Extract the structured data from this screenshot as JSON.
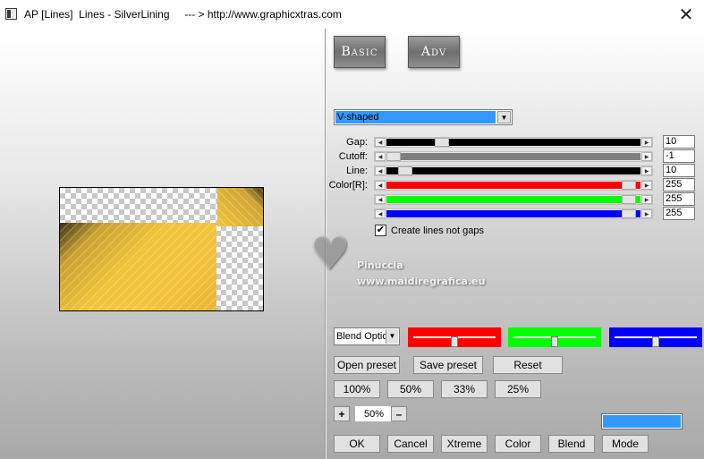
{
  "window": {
    "title": "AP [Lines]  Lines - SilverLining     --- > http://www.graphicxtras.com",
    "close_glyph": "✕"
  },
  "tabs": {
    "basic": "Basic",
    "adv": "Adv"
  },
  "style_select": {
    "value": "V-shaped"
  },
  "sliders": {
    "gap": {
      "label": "Gap:",
      "value": "10",
      "position": 0.2
    },
    "cutoff": {
      "label": "Cutoff:",
      "value": "-1",
      "position": 0.0
    },
    "line": {
      "label": "Line:",
      "value": "10",
      "position": 0.05
    },
    "color_r": {
      "label": "Color[R]:",
      "value": "255",
      "position": 0.98
    },
    "color_g": {
      "value": "255",
      "position": 0.98
    },
    "color_b": {
      "value": "255",
      "position": 0.98
    }
  },
  "checkbox": {
    "label": "Create lines not gaps",
    "checked": true,
    "mark": "✔"
  },
  "watermark": {
    "name": "Pinuccia",
    "url": "www.maidiregrafica.eu"
  },
  "blend": {
    "select_value": "Blend Optio"
  },
  "channel_bars": {
    "red": {
      "color": "#ff0000",
      "level": 0.5
    },
    "green": {
      "color": "#00ff00",
      "level": 0.5
    },
    "blue": {
      "color": "#0000ff",
      "level": 0.5
    }
  },
  "buttons": {
    "open_preset": "Open preset",
    "save_preset": "Save preset",
    "reset": "Reset",
    "zoom_100": "100%",
    "zoom_50": "50%",
    "zoom_33": "33%",
    "zoom_25": "25%",
    "plus": "+",
    "minus": "–",
    "ok": "OK",
    "cancel": "Cancel",
    "xtreme": "Xtreme",
    "color": "Color",
    "blend": "Blend",
    "mode": "Mode"
  },
  "zoom_value": "50%",
  "colors": {
    "slider_fill_black": "#000000",
    "slider_fill_gray": "#808080",
    "red": "#ff0000",
    "green": "#00ff00",
    "blue": "#0000ff",
    "swatch": "#3399ff",
    "selection": "#3399ff",
    "gold": "#f3c33c"
  }
}
